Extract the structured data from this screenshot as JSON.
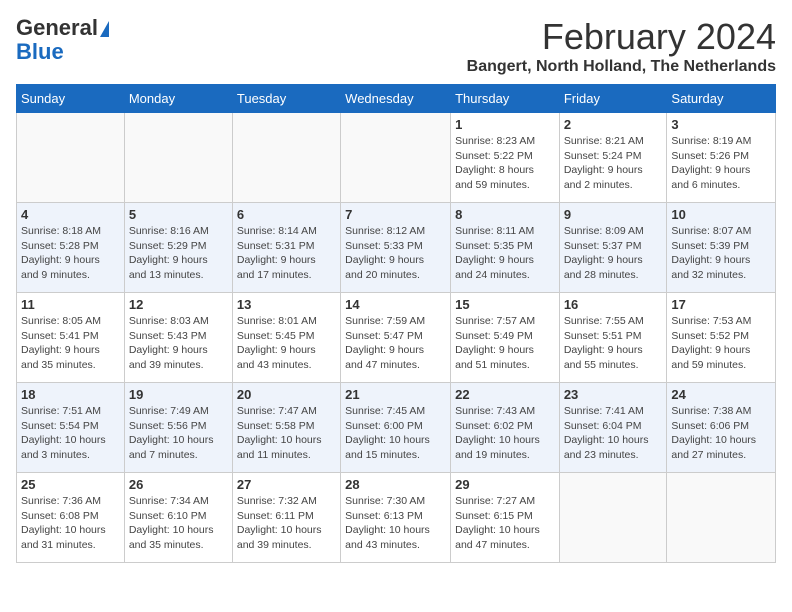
{
  "header": {
    "logo_general": "General",
    "logo_blue": "Blue",
    "month_title": "February 2024",
    "location": "Bangert, North Holland, The Netherlands"
  },
  "days_of_week": [
    "Sunday",
    "Monday",
    "Tuesday",
    "Wednesday",
    "Thursday",
    "Friday",
    "Saturday"
  ],
  "weeks": [
    [
      {
        "day": "",
        "info": ""
      },
      {
        "day": "",
        "info": ""
      },
      {
        "day": "",
        "info": ""
      },
      {
        "day": "",
        "info": ""
      },
      {
        "day": "1",
        "info": "Sunrise: 8:23 AM\nSunset: 5:22 PM\nDaylight: 8 hours\nand 59 minutes."
      },
      {
        "day": "2",
        "info": "Sunrise: 8:21 AM\nSunset: 5:24 PM\nDaylight: 9 hours\nand 2 minutes."
      },
      {
        "day": "3",
        "info": "Sunrise: 8:19 AM\nSunset: 5:26 PM\nDaylight: 9 hours\nand 6 minutes."
      }
    ],
    [
      {
        "day": "4",
        "info": "Sunrise: 8:18 AM\nSunset: 5:28 PM\nDaylight: 9 hours\nand 9 minutes."
      },
      {
        "day": "5",
        "info": "Sunrise: 8:16 AM\nSunset: 5:29 PM\nDaylight: 9 hours\nand 13 minutes."
      },
      {
        "day": "6",
        "info": "Sunrise: 8:14 AM\nSunset: 5:31 PM\nDaylight: 9 hours\nand 17 minutes."
      },
      {
        "day": "7",
        "info": "Sunrise: 8:12 AM\nSunset: 5:33 PM\nDaylight: 9 hours\nand 20 minutes."
      },
      {
        "day": "8",
        "info": "Sunrise: 8:11 AM\nSunset: 5:35 PM\nDaylight: 9 hours\nand 24 minutes."
      },
      {
        "day": "9",
        "info": "Sunrise: 8:09 AM\nSunset: 5:37 PM\nDaylight: 9 hours\nand 28 minutes."
      },
      {
        "day": "10",
        "info": "Sunrise: 8:07 AM\nSunset: 5:39 PM\nDaylight: 9 hours\nand 32 minutes."
      }
    ],
    [
      {
        "day": "11",
        "info": "Sunrise: 8:05 AM\nSunset: 5:41 PM\nDaylight: 9 hours\nand 35 minutes."
      },
      {
        "day": "12",
        "info": "Sunrise: 8:03 AM\nSunset: 5:43 PM\nDaylight: 9 hours\nand 39 minutes."
      },
      {
        "day": "13",
        "info": "Sunrise: 8:01 AM\nSunset: 5:45 PM\nDaylight: 9 hours\nand 43 minutes."
      },
      {
        "day": "14",
        "info": "Sunrise: 7:59 AM\nSunset: 5:47 PM\nDaylight: 9 hours\nand 47 minutes."
      },
      {
        "day": "15",
        "info": "Sunrise: 7:57 AM\nSunset: 5:49 PM\nDaylight: 9 hours\nand 51 minutes."
      },
      {
        "day": "16",
        "info": "Sunrise: 7:55 AM\nSunset: 5:51 PM\nDaylight: 9 hours\nand 55 minutes."
      },
      {
        "day": "17",
        "info": "Sunrise: 7:53 AM\nSunset: 5:52 PM\nDaylight: 9 hours\nand 59 minutes."
      }
    ],
    [
      {
        "day": "18",
        "info": "Sunrise: 7:51 AM\nSunset: 5:54 PM\nDaylight: 10 hours\nand 3 minutes."
      },
      {
        "day": "19",
        "info": "Sunrise: 7:49 AM\nSunset: 5:56 PM\nDaylight: 10 hours\nand 7 minutes."
      },
      {
        "day": "20",
        "info": "Sunrise: 7:47 AM\nSunset: 5:58 PM\nDaylight: 10 hours\nand 11 minutes."
      },
      {
        "day": "21",
        "info": "Sunrise: 7:45 AM\nSunset: 6:00 PM\nDaylight: 10 hours\nand 15 minutes."
      },
      {
        "day": "22",
        "info": "Sunrise: 7:43 AM\nSunset: 6:02 PM\nDaylight: 10 hours\nand 19 minutes."
      },
      {
        "day": "23",
        "info": "Sunrise: 7:41 AM\nSunset: 6:04 PM\nDaylight: 10 hours\nand 23 minutes."
      },
      {
        "day": "24",
        "info": "Sunrise: 7:38 AM\nSunset: 6:06 PM\nDaylight: 10 hours\nand 27 minutes."
      }
    ],
    [
      {
        "day": "25",
        "info": "Sunrise: 7:36 AM\nSunset: 6:08 PM\nDaylight: 10 hours\nand 31 minutes."
      },
      {
        "day": "26",
        "info": "Sunrise: 7:34 AM\nSunset: 6:10 PM\nDaylight: 10 hours\nand 35 minutes."
      },
      {
        "day": "27",
        "info": "Sunrise: 7:32 AM\nSunset: 6:11 PM\nDaylight: 10 hours\nand 39 minutes."
      },
      {
        "day": "28",
        "info": "Sunrise: 7:30 AM\nSunset: 6:13 PM\nDaylight: 10 hours\nand 43 minutes."
      },
      {
        "day": "29",
        "info": "Sunrise: 7:27 AM\nSunset: 6:15 PM\nDaylight: 10 hours\nand 47 minutes."
      },
      {
        "day": "",
        "info": ""
      },
      {
        "day": "",
        "info": ""
      }
    ]
  ]
}
